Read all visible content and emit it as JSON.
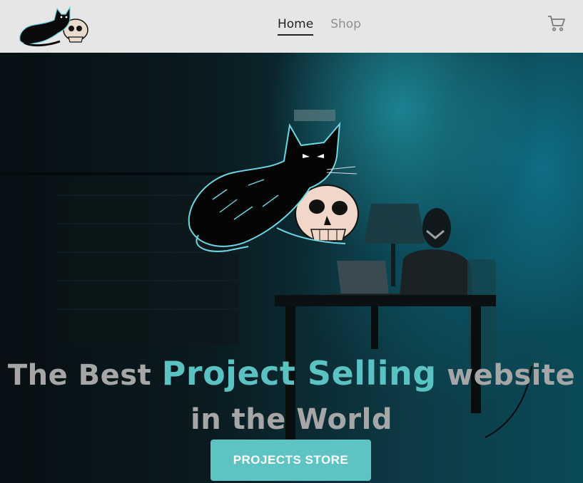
{
  "nav": {
    "links": [
      {
        "label": "Home",
        "active": true
      },
      {
        "label": "Shop",
        "active": false
      }
    ],
    "cart_icon": "cart-icon",
    "logo_icon": "cat-skull-logo"
  },
  "hero": {
    "headline_prefix": "The Best",
    "headline_accent": "Project Selling",
    "headline_suffix_1": "website",
    "headline_suffix_2": "in the World",
    "cta_label": "PROJECTS STORE",
    "illustration": "cat-skull-illustration"
  },
  "colors": {
    "accent": "#5bc2c4",
    "button": "#5ec3c3",
    "nav_bg": "#e6e6e6",
    "headline": "#a6a6a6"
  }
}
